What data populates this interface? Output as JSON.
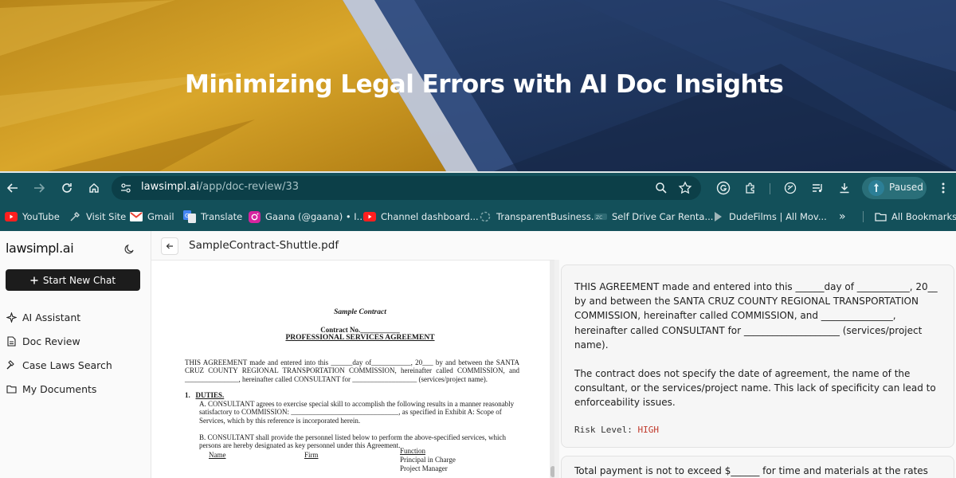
{
  "banner": {
    "title": "Minimizing Legal Errors with AI Doc Insights",
    "colors": {
      "gold": "#c9961c",
      "navy": "#1f3562"
    }
  },
  "browser": {
    "url_host": "lawsimpl.ai",
    "url_path": "/app/doc-review/33",
    "profile_status": "Paused",
    "bookmarks": [
      {
        "label": "YouTube",
        "icon": "youtube-icon"
      },
      {
        "label": "Visit Site",
        "icon": "tool-icon"
      },
      {
        "label": "Gmail",
        "icon": "gmail-icon"
      },
      {
        "label": "Translate",
        "icon": "translate-icon"
      },
      {
        "label": "Gaana (@gaana) • I...",
        "icon": "instagram-icon"
      },
      {
        "label": "Channel dashboard...",
        "icon": "youtube-icon"
      },
      {
        "label": "TransparentBusiness...",
        "icon": "loading-icon"
      },
      {
        "label": "Self Drive Car Renta...",
        "icon": "site-icon"
      },
      {
        "label": "DudeFilms | All Mov...",
        "icon": "play-icon"
      }
    ],
    "overflow": "»",
    "all_bookmarks": "All Bookmarks"
  },
  "sidebar": {
    "brand": "lawsimpl.ai",
    "new_chat": "Start New Chat",
    "items": [
      {
        "label": "AI Assistant",
        "icon": "sparkle-icon"
      },
      {
        "label": "Doc Review",
        "icon": "document-icon"
      },
      {
        "label": "Case Laws Search",
        "icon": "gavel-icon"
      },
      {
        "label": "My Documents",
        "icon": "folder-icon"
      }
    ]
  },
  "document": {
    "filename": "SampleContract-Shuttle.pdf",
    "pdf": {
      "title": "Sample Contract",
      "contract_no": "Contract No.___________",
      "heading": "PROFESSIONAL SERVICES AGREEMENT",
      "para": "THIS AGREEMENT made and entered into this ______day of___________, 20___ by and between the SANTA CRUZ COUNTY REGIONAL TRANSPORTATION COMMISSION, hereinafter called COMMISSION, and _______________, hereinafter called CONSULTANT for __________________ (services/project name).",
      "duties_num": "1.",
      "duties": "DUTIES.",
      "item_a": "A.  CONSULTANT agrees to exercise special skill to accomplish the following results in a manner reasonably satisfactory to COMMISSION: ______________________________, as specified in Exhibit A: Scope of Services, which by this reference is incorporated herein.",
      "item_b": "B.  CONSULTANT shall provide the personnel listed below to perform the above-specified services, which persons are hereby designated as key personnel under this Agreement.",
      "col_name": "Name",
      "col_firm": "Firm",
      "col_function": "Function",
      "fn1": "Principal in Charge",
      "fn2": "Project Manager"
    }
  },
  "insights": {
    "clause": "THIS AGREEMENT made and entered into this ______day of ___________, 20__ by and between the SANTA CRUZ COUNTY REGIONAL TRANSPORTATION COMMISSION, hereinafter called COMMISSION, and _______________, hereinafter called CONSULTANT for ____________________ (services/project name).",
    "analysis": "The contract does not specify the date of agreement, the name of the consultant, or the services/project name. This lack of specificity can lead to enforceability issues.",
    "risk_label": "Risk Level:",
    "risk_value": "HIGH",
    "next_clause": "Total payment is not to exceed $______ for time and materials at the rates and"
  }
}
